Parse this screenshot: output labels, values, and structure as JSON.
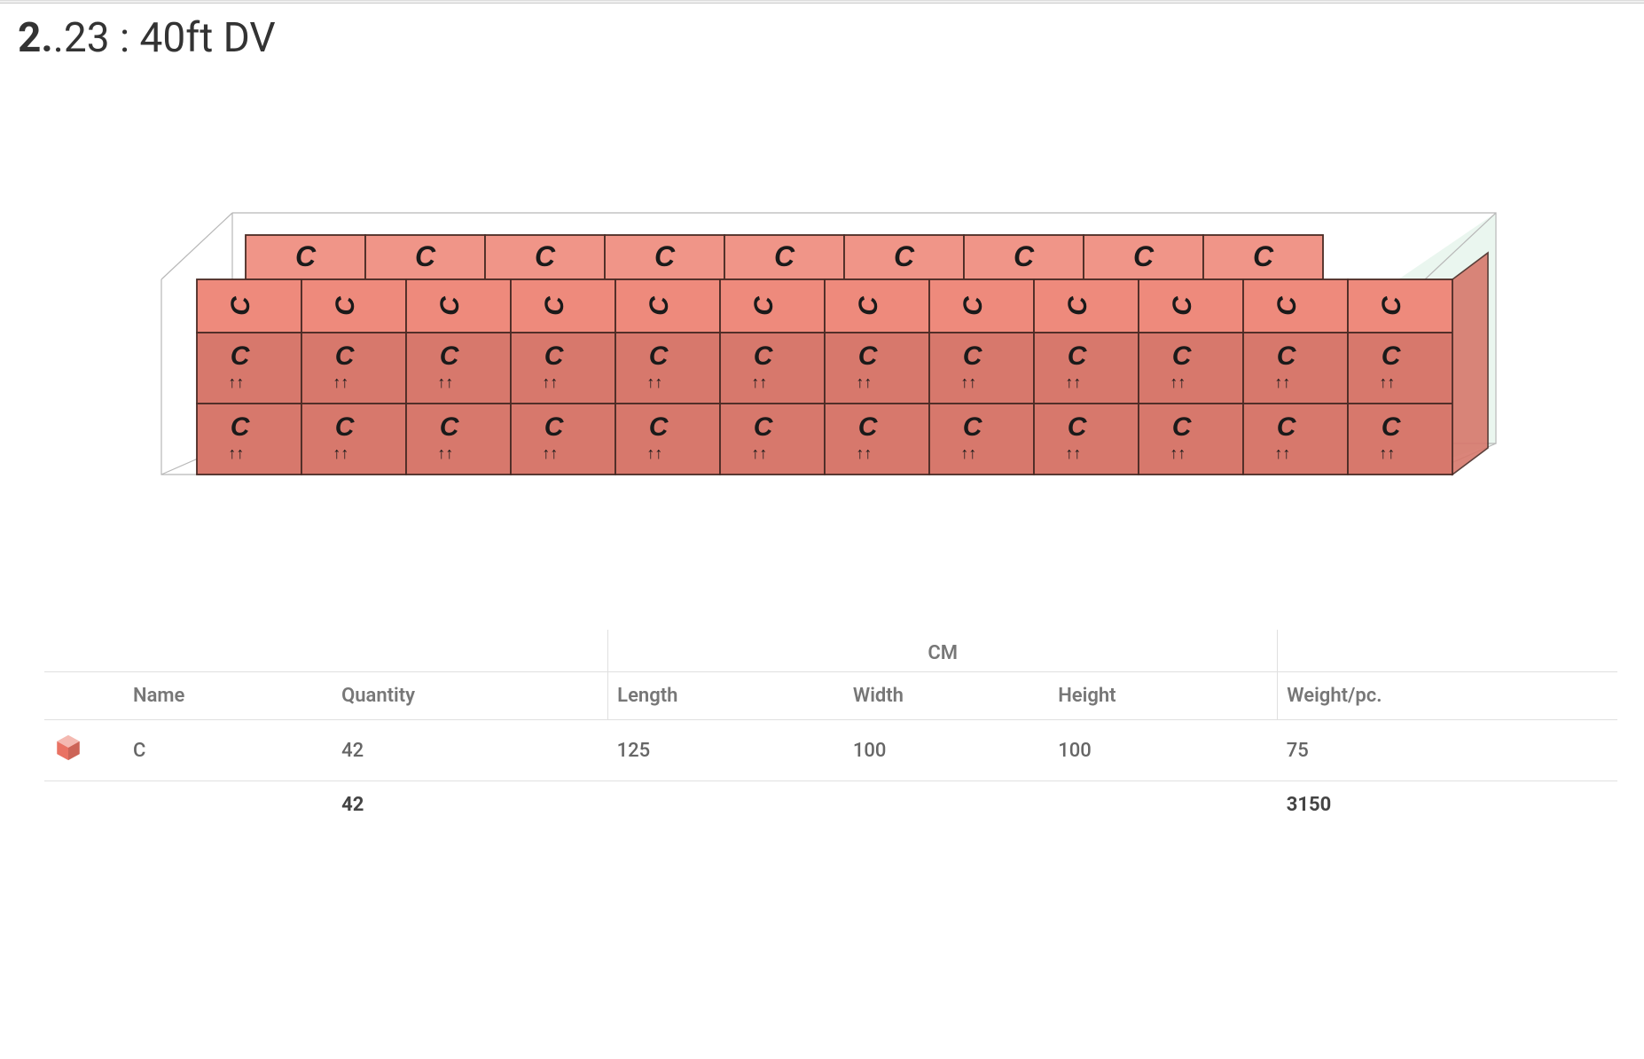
{
  "title": {
    "prefix": "2.",
    "rest": ".23 : 40ft DV"
  },
  "viz": {
    "box_label": "C",
    "arrows_glyph": "↑↑",
    "colors": {
      "box_top_back": "#f09588",
      "box_top_front": "#ee8a7c",
      "box_front": "#d7786c",
      "box_edge": "#4a2b25",
      "container_outline": "#b8b8b8",
      "container_fill_right": "#d6eee0"
    }
  },
  "table": {
    "cm_label": "CM",
    "headers": {
      "name": "Name",
      "quantity": "Quantity",
      "length": "Length",
      "width": "Width",
      "height": "Height",
      "weight": "Weight/pc."
    },
    "rows": [
      {
        "name": "C",
        "quantity": "42",
        "length": "125",
        "width": "100",
        "height": "100",
        "weight": "75"
      }
    ],
    "totals": {
      "quantity": "42",
      "weight": "3150"
    },
    "icon_color": "#e97263"
  }
}
